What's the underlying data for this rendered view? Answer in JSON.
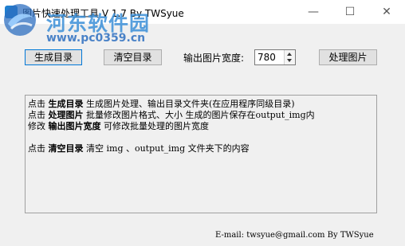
{
  "window": {
    "title": "图片快速处理工具 V 1.7 By TWSyue",
    "minimize_glyph": "—",
    "maximize_glyph": "☐",
    "close_glyph": "✕"
  },
  "watermark": {
    "name": "河东软件园",
    "url": "www.pc0359.cn"
  },
  "toolbar": {
    "generate_label": "生成目录",
    "clear_label": "清空目录",
    "width_label": "输出图片宽度:",
    "width_value": "780",
    "process_label": "处理图片"
  },
  "help": {
    "line1": {
      "prefix": "点击 ",
      "keyword": "生成目录",
      "text": " 生成图片处理、输出目录文件夹(在应用程序同级目录)"
    },
    "line2": {
      "prefix": "点击 ",
      "keyword": "处理图片",
      "text": " 批量修改图片格式、大小        生成的图片保存在output_img内"
    },
    "line3": {
      "prefix": "修改 ",
      "keyword": "输出图片宽度",
      "text": " 可修改批量处理的图片宽度"
    },
    "line4": {
      "prefix": "点击 ",
      "keyword": "清空目录",
      "text": " 清空 img 、output_img 文件夹下的内容"
    }
  },
  "footer": {
    "text": "E-mail: twsyue@gmail.com By TWSyue"
  },
  "icons": {
    "app": "app-icon",
    "logo": "watermark-logo-icon"
  },
  "colors": {
    "accent": "#0078d7",
    "watermark": "#3a8fd8",
    "background": "#f0f0f0"
  }
}
